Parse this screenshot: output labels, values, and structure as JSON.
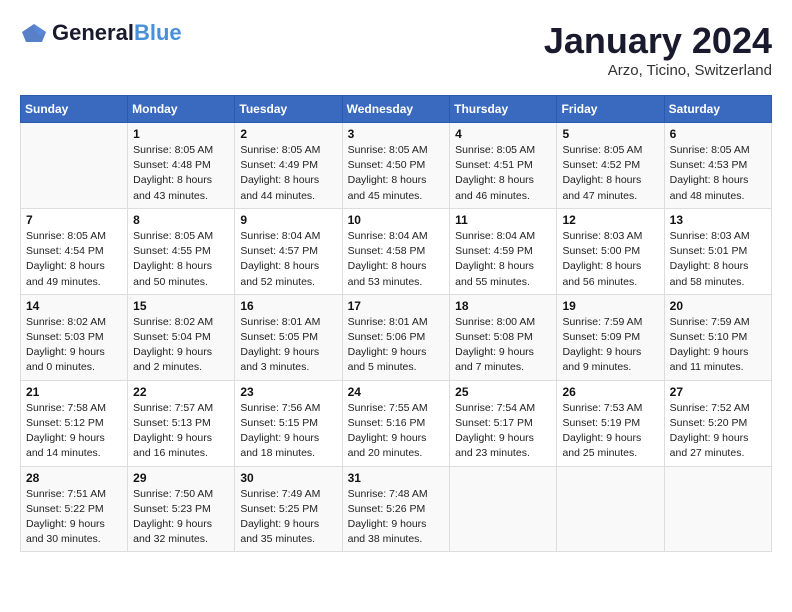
{
  "header": {
    "logo_general": "General",
    "logo_blue": "Blue",
    "main_title": "January 2024",
    "subtitle": "Arzo, Ticino, Switzerland"
  },
  "days_of_week": [
    "Sunday",
    "Monday",
    "Tuesday",
    "Wednesday",
    "Thursday",
    "Friday",
    "Saturday"
  ],
  "weeks": [
    [
      {
        "day": "",
        "info": ""
      },
      {
        "day": "1",
        "info": "Sunrise: 8:05 AM\nSunset: 4:48 PM\nDaylight: 8 hours\nand 43 minutes."
      },
      {
        "day": "2",
        "info": "Sunrise: 8:05 AM\nSunset: 4:49 PM\nDaylight: 8 hours\nand 44 minutes."
      },
      {
        "day": "3",
        "info": "Sunrise: 8:05 AM\nSunset: 4:50 PM\nDaylight: 8 hours\nand 45 minutes."
      },
      {
        "day": "4",
        "info": "Sunrise: 8:05 AM\nSunset: 4:51 PM\nDaylight: 8 hours\nand 46 minutes."
      },
      {
        "day": "5",
        "info": "Sunrise: 8:05 AM\nSunset: 4:52 PM\nDaylight: 8 hours\nand 47 minutes."
      },
      {
        "day": "6",
        "info": "Sunrise: 8:05 AM\nSunset: 4:53 PM\nDaylight: 8 hours\nand 48 minutes."
      }
    ],
    [
      {
        "day": "7",
        "info": "Sunrise: 8:05 AM\nSunset: 4:54 PM\nDaylight: 8 hours\nand 49 minutes."
      },
      {
        "day": "8",
        "info": "Sunrise: 8:05 AM\nSunset: 4:55 PM\nDaylight: 8 hours\nand 50 minutes."
      },
      {
        "day": "9",
        "info": "Sunrise: 8:04 AM\nSunset: 4:57 PM\nDaylight: 8 hours\nand 52 minutes."
      },
      {
        "day": "10",
        "info": "Sunrise: 8:04 AM\nSunset: 4:58 PM\nDaylight: 8 hours\nand 53 minutes."
      },
      {
        "day": "11",
        "info": "Sunrise: 8:04 AM\nSunset: 4:59 PM\nDaylight: 8 hours\nand 55 minutes."
      },
      {
        "day": "12",
        "info": "Sunrise: 8:03 AM\nSunset: 5:00 PM\nDaylight: 8 hours\nand 56 minutes."
      },
      {
        "day": "13",
        "info": "Sunrise: 8:03 AM\nSunset: 5:01 PM\nDaylight: 8 hours\nand 58 minutes."
      }
    ],
    [
      {
        "day": "14",
        "info": "Sunrise: 8:02 AM\nSunset: 5:03 PM\nDaylight: 9 hours\nand 0 minutes."
      },
      {
        "day": "15",
        "info": "Sunrise: 8:02 AM\nSunset: 5:04 PM\nDaylight: 9 hours\nand 2 minutes."
      },
      {
        "day": "16",
        "info": "Sunrise: 8:01 AM\nSunset: 5:05 PM\nDaylight: 9 hours\nand 3 minutes."
      },
      {
        "day": "17",
        "info": "Sunrise: 8:01 AM\nSunset: 5:06 PM\nDaylight: 9 hours\nand 5 minutes."
      },
      {
        "day": "18",
        "info": "Sunrise: 8:00 AM\nSunset: 5:08 PM\nDaylight: 9 hours\nand 7 minutes."
      },
      {
        "day": "19",
        "info": "Sunrise: 7:59 AM\nSunset: 5:09 PM\nDaylight: 9 hours\nand 9 minutes."
      },
      {
        "day": "20",
        "info": "Sunrise: 7:59 AM\nSunset: 5:10 PM\nDaylight: 9 hours\nand 11 minutes."
      }
    ],
    [
      {
        "day": "21",
        "info": "Sunrise: 7:58 AM\nSunset: 5:12 PM\nDaylight: 9 hours\nand 14 minutes."
      },
      {
        "day": "22",
        "info": "Sunrise: 7:57 AM\nSunset: 5:13 PM\nDaylight: 9 hours\nand 16 minutes."
      },
      {
        "day": "23",
        "info": "Sunrise: 7:56 AM\nSunset: 5:15 PM\nDaylight: 9 hours\nand 18 minutes."
      },
      {
        "day": "24",
        "info": "Sunrise: 7:55 AM\nSunset: 5:16 PM\nDaylight: 9 hours\nand 20 minutes."
      },
      {
        "day": "25",
        "info": "Sunrise: 7:54 AM\nSunset: 5:17 PM\nDaylight: 9 hours\nand 23 minutes."
      },
      {
        "day": "26",
        "info": "Sunrise: 7:53 AM\nSunset: 5:19 PM\nDaylight: 9 hours\nand 25 minutes."
      },
      {
        "day": "27",
        "info": "Sunrise: 7:52 AM\nSunset: 5:20 PM\nDaylight: 9 hours\nand 27 minutes."
      }
    ],
    [
      {
        "day": "28",
        "info": "Sunrise: 7:51 AM\nSunset: 5:22 PM\nDaylight: 9 hours\nand 30 minutes."
      },
      {
        "day": "29",
        "info": "Sunrise: 7:50 AM\nSunset: 5:23 PM\nDaylight: 9 hours\nand 32 minutes."
      },
      {
        "day": "30",
        "info": "Sunrise: 7:49 AM\nSunset: 5:25 PM\nDaylight: 9 hours\nand 35 minutes."
      },
      {
        "day": "31",
        "info": "Sunrise: 7:48 AM\nSunset: 5:26 PM\nDaylight: 9 hours\nand 38 minutes."
      },
      {
        "day": "",
        "info": ""
      },
      {
        "day": "",
        "info": ""
      },
      {
        "day": "",
        "info": ""
      }
    ]
  ]
}
